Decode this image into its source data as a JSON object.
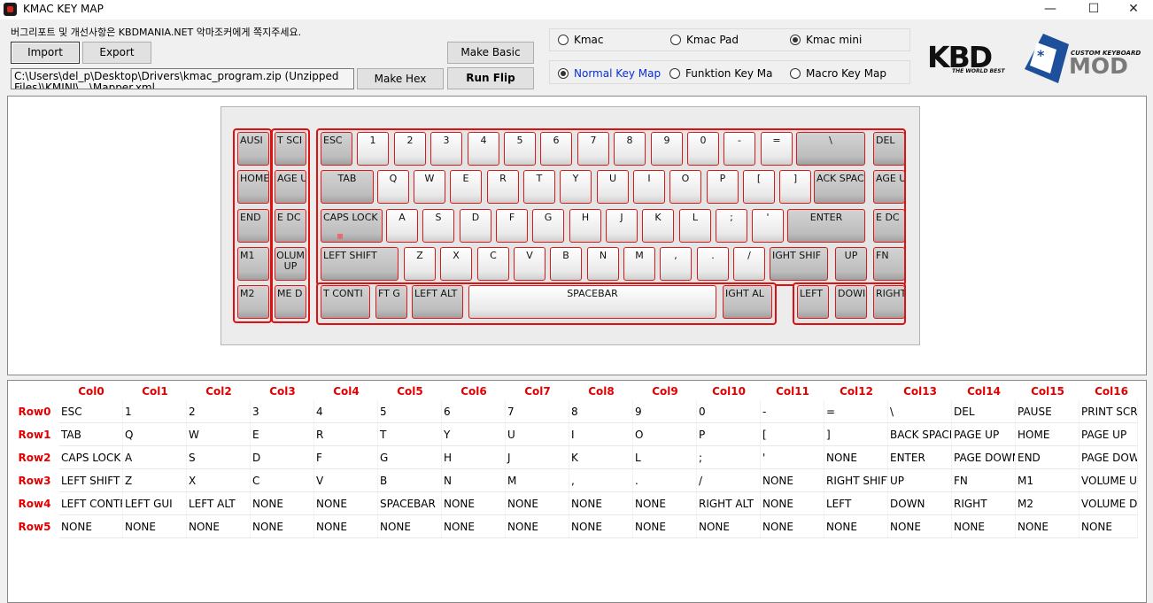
{
  "window": {
    "title": "KMAC KEY MAP",
    "min_glyph": "—",
    "max_glyph": "☐",
    "close_glyph": "✕"
  },
  "notice": "버그리포트 및 개선사항은 KBDMANIA.NET 악마조커에게 쪽지주세요.",
  "buttons": {
    "import": "Import",
    "export": "Export",
    "make_basic": "Make Basic XMLs",
    "make_hex": "Make Hex",
    "run_flip": "Run Flip"
  },
  "path": "C:\\Users\\del_p\\Desktop\\Drivers\\kmac_program.zip (Unzipped Files)\\KMINI\\...\\Mapper.xml",
  "models": [
    {
      "label": "Kmac",
      "selected": false
    },
    {
      "label": "Kmac Pad",
      "selected": false
    },
    {
      "label": "Kmac mini",
      "selected": true
    }
  ],
  "maps": [
    {
      "label": "Normal Key Map",
      "selected": true
    },
    {
      "label": "Funktion Key Map",
      "selected": false
    },
    {
      "label": "Macro Key Map",
      "selected": false
    }
  ],
  "logo": {
    "kbd": "KBD",
    "tagline": "THE WORLD BEST",
    "custom": "CUSTOM KEYBOARD",
    "mod": "MOD",
    "cap_symbol": "*"
  },
  "keyboard": {
    "left_keys": [
      "PAUSE",
      "PRINT SCREEN",
      "HOME",
      "PAGE UP",
      "END",
      "PAGE DOWN",
      "M1",
      "VOLUME UP",
      "M2",
      "VOLUME DOWN"
    ],
    "left_labels": [
      "AUSI",
      "T SCI",
      "HOME",
      "AGE U",
      "END",
      "E DC",
      "M1",
      "OLUM UP",
      "M2",
      "ME D"
    ],
    "row0": [
      "ESC",
      "1",
      "2",
      "3",
      "4",
      "5",
      "6",
      "7",
      "8",
      "9",
      "0",
      "-",
      "=",
      "\\",
      "DEL"
    ],
    "row1": [
      "TAB",
      "Q",
      "W",
      "E",
      "R",
      "T",
      "Y",
      "U",
      "I",
      "O",
      "P",
      "[",
      "]",
      "ACK SPAC",
      "AGE U"
    ],
    "row2": [
      "CAPS LOCK",
      "A",
      "S",
      "D",
      "F",
      "G",
      "H",
      "J",
      "K",
      "L",
      ";",
      "'",
      "ENTER",
      "E DC"
    ],
    "row3": [
      "LEFT SHIFT",
      "Z",
      "X",
      "C",
      "V",
      "B",
      "N",
      "M",
      ",",
      ".",
      "/",
      "IGHT SHIF",
      "UP",
      "FN"
    ],
    "row4": [
      "T CONTI",
      "FT G",
      "LEFT ALT",
      "SPACEBAR",
      "IGHT AL",
      "LEFT",
      "DOWN",
      "RIGHT"
    ],
    "row4_labels": [
      "T CONTI",
      "FT G",
      "LEFT ALT",
      "SPACEBAR",
      "IGHT AL",
      "LEFT",
      "DOWI",
      "RIGHT"
    ]
  },
  "table": {
    "columns": [
      "Col0",
      "Col1",
      "Col2",
      "Col3",
      "Col4",
      "Col5",
      "Col6",
      "Col7",
      "Col8",
      "Col9",
      "Col10",
      "Col11",
      "Col12",
      "Col13",
      "Col14",
      "Col15",
      "Col16"
    ],
    "rows": [
      {
        "name": "Row0",
        "cells": [
          "ESC",
          "1",
          "2",
          "3",
          "4",
          "5",
          "6",
          "7",
          "8",
          "9",
          "0",
          "-",
          "=",
          "\\",
          "DEL",
          "PAUSE",
          "PRINT SCREEN"
        ]
      },
      {
        "name": "Row1",
        "cells": [
          "TAB",
          "Q",
          "W",
          "E",
          "R",
          "T",
          "Y",
          "U",
          "I",
          "O",
          "P",
          "[",
          "]",
          "BACK SPACE",
          "PAGE UP",
          "HOME",
          "PAGE UP"
        ]
      },
      {
        "name": "Row2",
        "cells": [
          "CAPS LOCK",
          "A",
          "S",
          "D",
          "F",
          "G",
          "H",
          "J",
          "K",
          "L",
          ";",
          "'",
          "NONE",
          "ENTER",
          "PAGE DOWN",
          "END",
          "PAGE DOWN"
        ]
      },
      {
        "name": "Row3",
        "cells": [
          "LEFT SHIFT",
          "Z",
          "X",
          "C",
          "V",
          "B",
          "N",
          "M",
          ",",
          ".",
          "/",
          "NONE",
          "RIGHT SHIFT",
          "UP",
          "FN",
          "M1",
          "VOLUME UP"
        ]
      },
      {
        "name": "Row4",
        "cells": [
          "LEFT CONTROL",
          "LEFT GUI",
          "LEFT ALT",
          "NONE",
          "NONE",
          "SPACEBAR",
          "NONE",
          "NONE",
          "NONE",
          "NONE",
          "RIGHT ALT",
          "NONE",
          "LEFT",
          "DOWN",
          "RIGHT",
          "M2",
          "VOLUME DOWN"
        ]
      },
      {
        "name": "Row5",
        "cells": [
          "NONE",
          "NONE",
          "NONE",
          "NONE",
          "NONE",
          "NONE",
          "NONE",
          "NONE",
          "NONE",
          "NONE",
          "NONE",
          "NONE",
          "NONE",
          "NONE",
          "NONE",
          "NONE",
          "NONE"
        ]
      }
    ]
  },
  "colors": {
    "accent": "#e00000",
    "selected_radio_text": "#0b2fd6",
    "logo_blue": "#1d4f9b"
  }
}
